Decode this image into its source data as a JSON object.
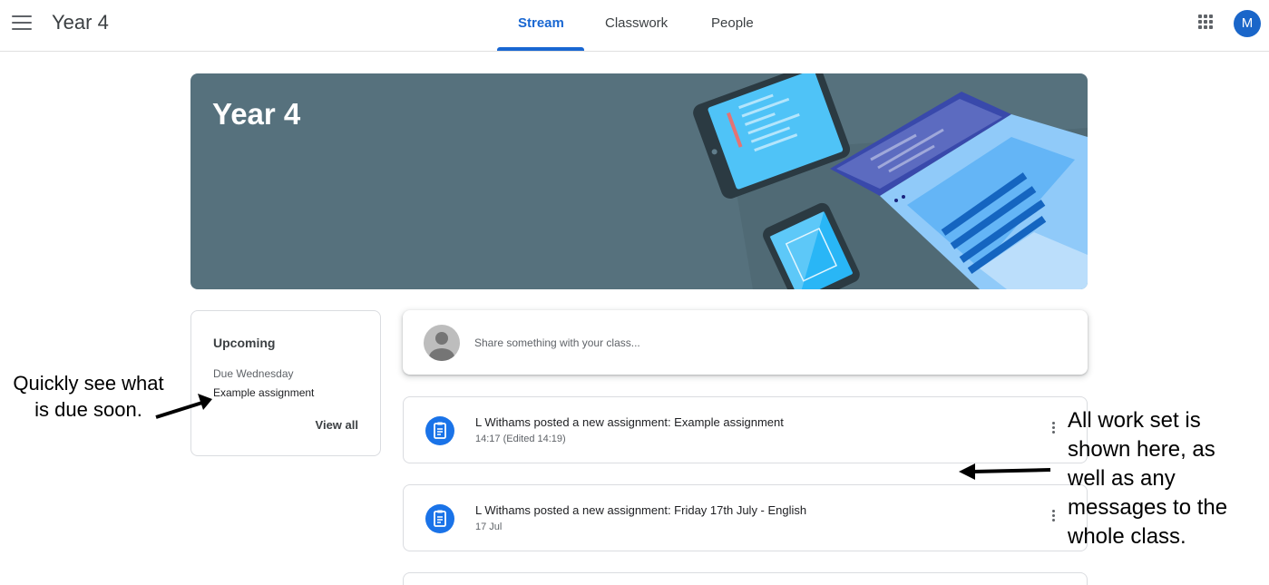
{
  "header": {
    "class_name": "Year 4",
    "tabs": [
      {
        "label": "Stream",
        "active": true
      },
      {
        "label": "Classwork",
        "active": false
      },
      {
        "label": "People",
        "active": false
      }
    ],
    "avatar_initial": "M",
    "accent_color": "#1967d2"
  },
  "banner": {
    "title": "Year 4",
    "background_color": "#56717d"
  },
  "upcoming": {
    "title": "Upcoming",
    "due": "Due Wednesday",
    "item": "Example assignment",
    "view_all": "View all"
  },
  "share": {
    "placeholder": "Share something with your class..."
  },
  "posts": [
    {
      "title": "L Withams posted a new assignment: Example assignment",
      "time": "14:17 (Edited 14:19)"
    },
    {
      "title": "L Withams posted a new assignment: Friday 17th July - English",
      "time": "17 Jul"
    }
  ],
  "annotations": {
    "left_line1": "Quickly see what",
    "left_line2": "is due soon.",
    "right_line1": "All work set is",
    "right_line2": "shown here, as",
    "right_line3": "well as any",
    "right_line4": "messages to the",
    "right_line5": "whole class."
  }
}
